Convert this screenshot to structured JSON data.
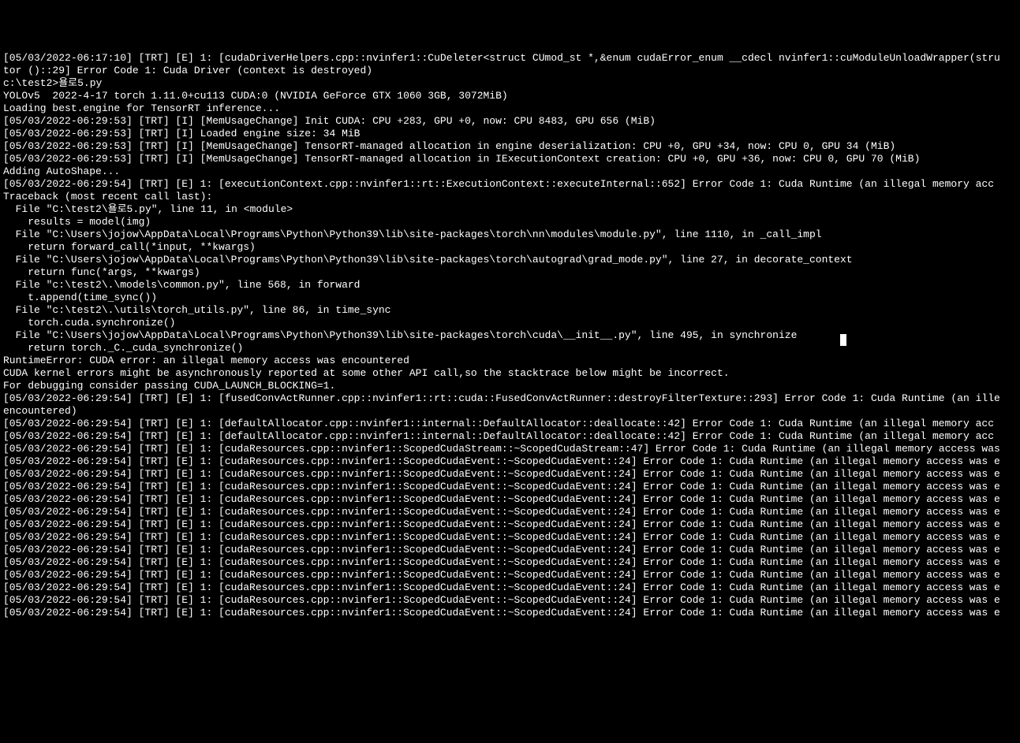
{
  "lines": [
    "[05/03/2022-06:17:10] [TRT] [E] 1: [cudaDriverHelpers.cpp::nvinfer1::CuDeleter<struct CUmod_st *,&enum cudaError_enum __cdecl nvinfer1::cuModuleUnloadWrapper(stru",
    "tor ()::29] Error Code 1: Cuda Driver (context is destroyed)",
    "",
    "c:\\test2>욜로5.py",
    "YOLOv5  2022-4-17 torch 1.11.0+cu113 CUDA:0 (NVIDIA GeForce GTX 1060 3GB, 3072MiB)",
    "",
    "Loading best.engine for TensorRT inference...",
    "[05/03/2022-06:29:53] [TRT] [I] [MemUsageChange] Init CUDA: CPU +283, GPU +0, now: CPU 8483, GPU 656 (MiB)",
    "[05/03/2022-06:29:53] [TRT] [I] Loaded engine size: 34 MiB",
    "[05/03/2022-06:29:53] [TRT] [I] [MemUsageChange] TensorRT-managed allocation in engine deserialization: CPU +0, GPU +34, now: CPU 0, GPU 34 (MiB)",
    "[05/03/2022-06:29:53] [TRT] [I] [MemUsageChange] TensorRT-managed allocation in IExecutionContext creation: CPU +0, GPU +36, now: CPU 0, GPU 70 (MiB)",
    "Adding AutoShape...",
    "[05/03/2022-06:29:54] [TRT] [E] 1: [executionContext.cpp::nvinfer1::rt::ExecutionContext::executeInternal::652] Error Code 1: Cuda Runtime (an illegal memory acc",
    "Traceback (most recent call last):",
    "  File \"C:\\test2\\욜로5.py\", line 11, in <module>",
    "    results = model(img)",
    "  File \"C:\\Users\\jojow\\AppData\\Local\\Programs\\Python\\Python39\\lib\\site-packages\\torch\\nn\\modules\\module.py\", line 1110, in _call_impl",
    "    return forward_call(*input, **kwargs)",
    "  File \"C:\\Users\\jojow\\AppData\\Local\\Programs\\Python\\Python39\\lib\\site-packages\\torch\\autograd\\grad_mode.py\", line 27, in decorate_context",
    "    return func(*args, **kwargs)",
    "  File \"c:\\test2\\.\\models\\common.py\", line 568, in forward",
    "    t.append(time_sync())",
    "  File \"c:\\test2\\.\\utils\\torch_utils.py\", line 86, in time_sync",
    "    torch.cuda.synchronize()",
    "  File \"C:\\Users\\jojow\\AppData\\Local\\Programs\\Python\\Python39\\lib\\site-packages\\torch\\cuda\\__init__.py\", line 495, in synchronize",
    "    return torch._C._cuda_synchronize()",
    "RuntimeError: CUDA error: an illegal memory access was encountered",
    "CUDA kernel errors might be asynchronously reported at some other API call,so the stacktrace below might be incorrect.",
    "For debugging consider passing CUDA_LAUNCH_BLOCKING=1.",
    "[05/03/2022-06:29:54] [TRT] [E] 1: [fusedConvActRunner.cpp::nvinfer1::rt::cuda::FusedConvActRunner::destroyFilterTexture::293] Error Code 1: Cuda Runtime (an ille",
    "encountered)",
    "[05/03/2022-06:29:54] [TRT] [E] 1: [defaultAllocator.cpp::nvinfer1::internal::DefaultAllocator::deallocate::42] Error Code 1: Cuda Runtime (an illegal memory acc",
    "[05/03/2022-06:29:54] [TRT] [E] 1: [defaultAllocator.cpp::nvinfer1::internal::DefaultAllocator::deallocate::42] Error Code 1: Cuda Runtime (an illegal memory acc",
    "[05/03/2022-06:29:54] [TRT] [E] 1: [cudaResources.cpp::nvinfer1::ScopedCudaStream::~ScopedCudaStream::47] Error Code 1: Cuda Runtime (an illegal memory access was",
    "[05/03/2022-06:29:54] [TRT] [E] 1: [cudaResources.cpp::nvinfer1::ScopedCudaEvent::~ScopedCudaEvent::24] Error Code 1: Cuda Runtime (an illegal memory access was e",
    "[05/03/2022-06:29:54] [TRT] [E] 1: [cudaResources.cpp::nvinfer1::ScopedCudaEvent::~ScopedCudaEvent::24] Error Code 1: Cuda Runtime (an illegal memory access was e",
    "[05/03/2022-06:29:54] [TRT] [E] 1: [cudaResources.cpp::nvinfer1::ScopedCudaEvent::~ScopedCudaEvent::24] Error Code 1: Cuda Runtime (an illegal memory access was e",
    "[05/03/2022-06:29:54] [TRT] [E] 1: [cudaResources.cpp::nvinfer1::ScopedCudaEvent::~ScopedCudaEvent::24] Error Code 1: Cuda Runtime (an illegal memory access was e",
    "[05/03/2022-06:29:54] [TRT] [E] 1: [cudaResources.cpp::nvinfer1::ScopedCudaEvent::~ScopedCudaEvent::24] Error Code 1: Cuda Runtime (an illegal memory access was e",
    "[05/03/2022-06:29:54] [TRT] [E] 1: [cudaResources.cpp::nvinfer1::ScopedCudaEvent::~ScopedCudaEvent::24] Error Code 1: Cuda Runtime (an illegal memory access was e",
    "[05/03/2022-06:29:54] [TRT] [E] 1: [cudaResources.cpp::nvinfer1::ScopedCudaEvent::~ScopedCudaEvent::24] Error Code 1: Cuda Runtime (an illegal memory access was e",
    "[05/03/2022-06:29:54] [TRT] [E] 1: [cudaResources.cpp::nvinfer1::ScopedCudaEvent::~ScopedCudaEvent::24] Error Code 1: Cuda Runtime (an illegal memory access was e",
    "[05/03/2022-06:29:54] [TRT] [E] 1: [cudaResources.cpp::nvinfer1::ScopedCudaEvent::~ScopedCudaEvent::24] Error Code 1: Cuda Runtime (an illegal memory access was e",
    "[05/03/2022-06:29:54] [TRT] [E] 1: [cudaResources.cpp::nvinfer1::ScopedCudaEvent::~ScopedCudaEvent::24] Error Code 1: Cuda Runtime (an illegal memory access was e",
    "[05/03/2022-06:29:54] [TRT] [E] 1: [cudaResources.cpp::nvinfer1::ScopedCudaEvent::~ScopedCudaEvent::24] Error Code 1: Cuda Runtime (an illegal memory access was e",
    "[05/03/2022-06:29:54] [TRT] [E] 1: [cudaResources.cpp::nvinfer1::ScopedCudaEvent::~ScopedCudaEvent::24] Error Code 1: Cuda Runtime (an illegal memory access was e",
    "[05/03/2022-06:29:54] [TRT] [E] 1: [cudaResources.cpp::nvinfer1::ScopedCudaEvent::~ScopedCudaEvent::24] Error Code 1: Cuda Runtime (an illegal memory access was e"
  ]
}
